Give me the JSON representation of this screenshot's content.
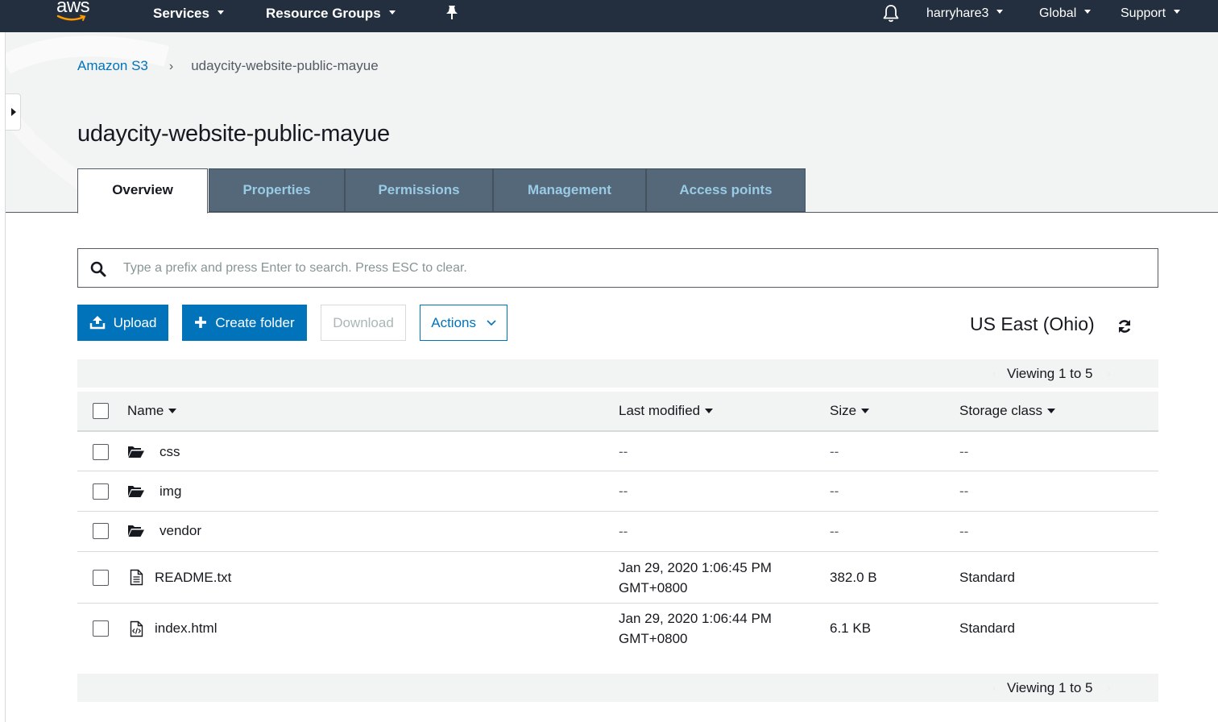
{
  "nav": {
    "logo_text": "aws",
    "services": "Services",
    "resource_groups": "Resource Groups",
    "user": "harryhare3",
    "region_menu": "Global",
    "support": "Support"
  },
  "breadcrumb": {
    "root": "Amazon S3",
    "separator": "›",
    "current": "udaycity-website-public-mayue"
  },
  "page_title": "udaycity-website-public-mayue",
  "tabs": [
    {
      "label": "Overview",
      "active": true
    },
    {
      "label": "Properties",
      "active": false
    },
    {
      "label": "Permissions",
      "active": false
    },
    {
      "label": "Management",
      "active": false
    },
    {
      "label": "Access points",
      "active": false
    }
  ],
  "search": {
    "placeholder": "Type a prefix and press Enter to search. Press ESC to clear.",
    "value": ""
  },
  "toolbar": {
    "upload": "Upload",
    "create_folder": "Create folder",
    "download": "Download",
    "actions": "Actions",
    "region": "US East (Ohio)"
  },
  "pager": {
    "text": "Viewing 1 to 5"
  },
  "table": {
    "headers": {
      "name": "Name",
      "last_modified": "Last modified",
      "size": "Size",
      "storage_class": "Storage class"
    },
    "rows": [
      {
        "name": "css",
        "type": "folder",
        "modified_line1": "--",
        "modified_line2": "",
        "size": "--",
        "storage": "--"
      },
      {
        "name": "img",
        "type": "folder",
        "modified_line1": "--",
        "modified_line2": "",
        "size": "--",
        "storage": "--"
      },
      {
        "name": "vendor",
        "type": "folder",
        "modified_line1": "--",
        "modified_line2": "",
        "size": "--",
        "storage": "--"
      },
      {
        "name": "README.txt",
        "type": "text-file",
        "modified_line1": "Jan 29, 2020 1:06:45 PM",
        "modified_line2": "GMT+0800",
        "size": "382.0 B",
        "storage": "Standard"
      },
      {
        "name": "index.html",
        "type": "code-file",
        "modified_line1": "Jan 29, 2020 1:06:44 PM",
        "modified_line2": "GMT+0800",
        "size": "6.1 KB",
        "storage": "Standard"
      }
    ]
  },
  "colors": {
    "nav_bg": "#232f3e",
    "primary": "#0073bb",
    "tab_bg": "#54687a",
    "tab_text": "#99cbe4",
    "header_bg": "#f2f3f3"
  },
  "icons": [
    "aws-logo",
    "caret-down-icon",
    "pin-icon",
    "bell-icon",
    "search-icon",
    "upload-icon",
    "plus-icon",
    "chevron-down-icon",
    "refresh-icon",
    "folder-open-icon",
    "text-file-icon",
    "code-file-icon",
    "sidebar-toggle-icon"
  ]
}
